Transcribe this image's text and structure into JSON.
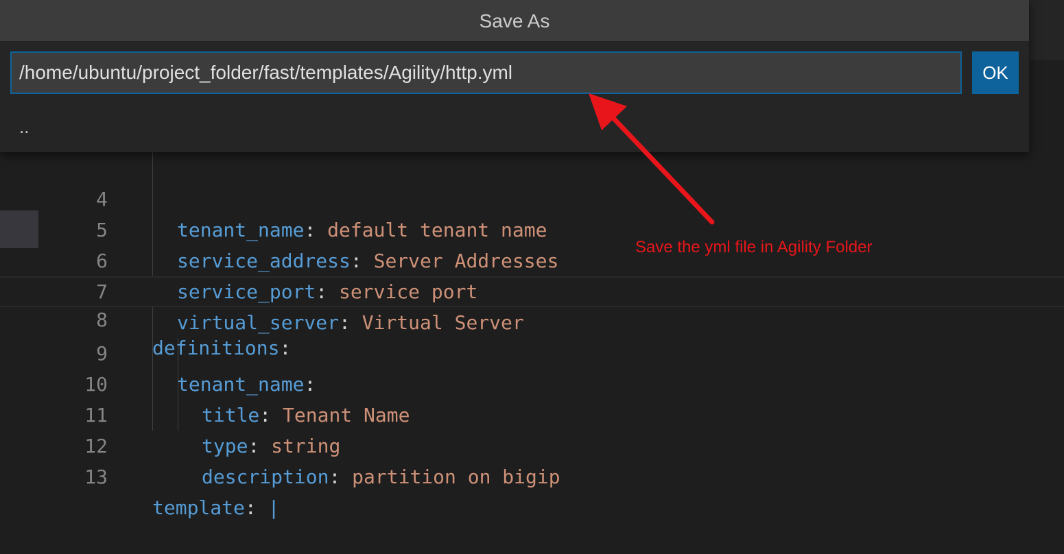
{
  "dialog": {
    "title": "Save As",
    "path_value": "/home/ubuntu/project_folder/fast/templates/Agility/http.yml",
    "ok_label": "OK",
    "parent_dir": ".."
  },
  "editor": {
    "lines": [
      {
        "num": "4",
        "key": "tenant_name",
        "sep": ": ",
        "value": "default tenant name"
      },
      {
        "num": "5",
        "key": "service_address",
        "sep": ": ",
        "value": "Server Addresses"
      },
      {
        "num": "6",
        "key": "service_port",
        "sep": ": ",
        "value": "service port"
      },
      {
        "num": "7",
        "key": "virtual_server",
        "sep": ": ",
        "value": "Virtual Server"
      },
      {
        "num": "8",
        "key": "definitions",
        "sep": ":",
        "value": ""
      },
      {
        "num": "9",
        "key": "tenant_name",
        "sep": ":",
        "value": ""
      },
      {
        "num": "10",
        "key": "title",
        "sep": ": ",
        "value": "Tenant Name"
      },
      {
        "num": "11",
        "key": "type",
        "sep": ": ",
        "value": "string"
      },
      {
        "num": "12",
        "key": "description",
        "sep": ": ",
        "value": "partition on bigip"
      },
      {
        "num": "13",
        "key": "template",
        "sep": ": ",
        "value": "|"
      }
    ]
  },
  "annotation": {
    "text": "Save the yml file in Agility Folder",
    "color": "#e8161b"
  },
  "theme": {
    "key_color": "#569cd6",
    "string_color": "#ce9178",
    "accent": "#0e639c"
  }
}
